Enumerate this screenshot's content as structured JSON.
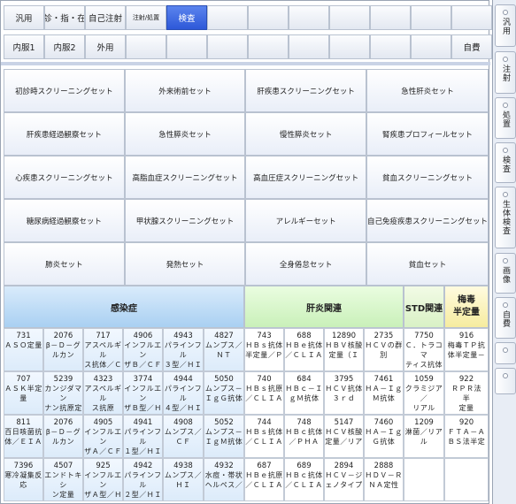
{
  "tabs_row1": [
    {
      "label": "汎用",
      "small": false,
      "active": false
    },
    {
      "label": "診・指・在",
      "small": false,
      "active": false
    },
    {
      "label": "自己注射",
      "small": false,
      "active": false
    },
    {
      "label": "注射/処置",
      "small": true,
      "active": false
    },
    {
      "label": "検査",
      "small": false,
      "active": true
    },
    {
      "label": "",
      "small": false,
      "active": false
    },
    {
      "label": "",
      "small": false,
      "active": false
    },
    {
      "label": "",
      "small": false,
      "active": false
    },
    {
      "label": "",
      "small": false,
      "active": false
    },
    {
      "label": "",
      "small": false,
      "active": false
    },
    {
      "label": "",
      "small": false,
      "active": false
    },
    {
      "label": "",
      "small": false,
      "active": false
    }
  ],
  "tabs_row2": [
    {
      "label": "内服1"
    },
    {
      "label": "内服2"
    },
    {
      "label": "外用"
    },
    {
      "label": ""
    },
    {
      "label": ""
    },
    {
      "label": ""
    },
    {
      "label": ""
    },
    {
      "label": ""
    },
    {
      "label": ""
    },
    {
      "label": ""
    },
    {
      "label": ""
    },
    {
      "label": "自費"
    }
  ],
  "sets": [
    "初診時スクリーニングセット",
    "外来術前セット",
    "肝疾患スクリーニングセット",
    "急性肝炎セット",
    "肝疾患経過観察セット",
    "急性膵炎セット",
    "慢性膵炎セット",
    "腎疾患プロフィールセット",
    "心疾患スクリーニングセット",
    "高脂血症スクリーニングセット",
    "高血圧症スクリーニングセット",
    "貧血スクリーニングセット",
    "糖尿病経過観察セット",
    "甲状腺スクリーニングセット",
    "アレルギーセット",
    "自己免疫疾患スクリーニングセット",
    "肺炎セット",
    "発熱セット",
    "全身倦怠セット",
    "貧血セット"
  ],
  "headers": {
    "infection": "感染症",
    "hepatitis": "肝炎関連",
    "std": "STD関連",
    "syphilis_line1": "梅毒",
    "syphilis_line2": "半定量"
  },
  "items": [
    {
      "code": "731",
      "lines": [
        "ＡＳＯ定量"
      ],
      "grp": "inf"
    },
    {
      "code": "2076",
      "lines": [
        "β－Ｄ－グ",
        "ルカン"
      ],
      "grp": "inf"
    },
    {
      "code": "717",
      "lines": [
        "アスペルギル",
        "ス抗体／Ｃ"
      ],
      "grp": "inf"
    },
    {
      "code": "4906",
      "lines": [
        "インフルエン",
        "ザＢ／ＣＦ"
      ],
      "grp": "inf"
    },
    {
      "code": "4943",
      "lines": [
        "パラインフル",
        "３型／ＨＩ"
      ],
      "grp": "inf"
    },
    {
      "code": "4827",
      "lines": [
        "ムンプス／",
        "ＮＴ"
      ],
      "grp": "inf"
    },
    {
      "code": "743",
      "lines": [
        "ＨＢｓ抗体",
        "半定量／Ｐ"
      ],
      "grp": "liv"
    },
    {
      "code": "688",
      "lines": [
        "ＨＢｅ抗体",
        "／ＣＬＩＡ"
      ],
      "grp": "liv"
    },
    {
      "code": "12890",
      "lines": [
        "ＨＢＶ核酸",
        "定量（Ｉ"
      ],
      "grp": "liv"
    },
    {
      "code": "2735",
      "lines": [
        "ＨＣＶの群",
        "別"
      ],
      "grp": "liv"
    },
    {
      "code": "7750",
      "lines": [
        "Ｃ．トラコマ",
        "ティス抗体"
      ],
      "grp": "liv"
    },
    {
      "code": "916",
      "lines": [
        "梅毒ＴＰ抗",
        "体半定量－"
      ],
      "grp": "liv"
    },
    {
      "code": "707",
      "lines": [
        "ＡＳＫ半定",
        "量"
      ],
      "grp": "inf"
    },
    {
      "code": "5239",
      "lines": [
        "カンジダマン",
        "ナン抗原定"
      ],
      "grp": "inf"
    },
    {
      "code": "4323",
      "lines": [
        "アスペルギル",
        "ス抗原"
      ],
      "grp": "inf"
    },
    {
      "code": "3774",
      "lines": [
        "インフルエン",
        "ザＢ型／Ｈ"
      ],
      "grp": "inf"
    },
    {
      "code": "4944",
      "lines": [
        "パラインフル",
        "４型／ＨＩ"
      ],
      "grp": "inf"
    },
    {
      "code": "5050",
      "lines": [
        "ムンプス－",
        "ＩｇＧ抗体"
      ],
      "grp": "inf"
    },
    {
      "code": "740",
      "lines": [
        "ＨＢｓ抗原",
        "／ＣＬＩＡ"
      ],
      "grp": "liv"
    },
    {
      "code": "684",
      "lines": [
        "ＨＢｃ－Ｉ",
        "ｇＭ抗体"
      ],
      "grp": "liv"
    },
    {
      "code": "3795",
      "lines": [
        "ＨＣＶ抗体",
        "３ｒｄ"
      ],
      "grp": "liv"
    },
    {
      "code": "7461",
      "lines": [
        "ＨＡ－Ｉｇ",
        "Ｍ抗体"
      ],
      "grp": "liv"
    },
    {
      "code": "1059",
      "lines": [
        "クラミジア／",
        "リアル"
      ],
      "grp": "liv"
    },
    {
      "code": "922",
      "lines": [
        "ＲＰＲ法　半",
        "定量"
      ],
      "grp": "liv"
    },
    {
      "code": "811",
      "lines": [
        "百日咳菌抗",
        "体／ＥＩＡ"
      ],
      "grp": "inf"
    },
    {
      "code": "2076",
      "lines": [
        "β－Ｄ－グ",
        "ルカン"
      ],
      "grp": "inf"
    },
    {
      "code": "4905",
      "lines": [
        "インフルエン",
        "ザＡ／ＣＦ"
      ],
      "grp": "inf"
    },
    {
      "code": "4941",
      "lines": [
        "パラインフル",
        "１型／ＨＩ"
      ],
      "grp": "inf"
    },
    {
      "code": "4908",
      "lines": [
        "ムンプス／",
        "ＣＦ"
      ],
      "grp": "inf"
    },
    {
      "code": "5052",
      "lines": [
        "ムンプス－",
        "ＩｇＭ抗体"
      ],
      "grp": "inf"
    },
    {
      "code": "744",
      "lines": [
        "ＨＢｓ抗体",
        "／ＣＬＩＡ"
      ],
      "grp": "liv"
    },
    {
      "code": "748",
      "lines": [
        "ＨＢｃ抗体",
        "／ＰＨＡ"
      ],
      "grp": "liv"
    },
    {
      "code": "5147",
      "lines": [
        "ＨＣＶ核酸",
        "定量／リア"
      ],
      "grp": "liv"
    },
    {
      "code": "7460",
      "lines": [
        "ＨＡ－Ｉｇ",
        "Ｇ抗体"
      ],
      "grp": "liv"
    },
    {
      "code": "1209",
      "lines": [
        "淋菌／リア",
        "ル"
      ],
      "grp": "liv"
    },
    {
      "code": "920",
      "lines": [
        "ＦＴＡ－Ａ",
        "ＢＳ法半定"
      ],
      "grp": "liv"
    },
    {
      "code": "7396",
      "lines": [
        "寒冷凝集反",
        "応"
      ],
      "grp": "inf"
    },
    {
      "code": "4507",
      "lines": [
        "エンドトキシ",
        "ン定量"
      ],
      "grp": "inf"
    },
    {
      "code": "925",
      "lines": [
        "インフルエン",
        "ザＡ型／Ｈ"
      ],
      "grp": "inf"
    },
    {
      "code": "4942",
      "lines": [
        "パラインフル",
        "２型／ＨＩ"
      ],
      "grp": "inf"
    },
    {
      "code": "4938",
      "lines": [
        "ムンプス／",
        "ＨＩ"
      ],
      "grp": "inf"
    },
    {
      "code": "4932",
      "lines": [
        "水痘・帯状",
        "ヘルペス／"
      ],
      "grp": "inf"
    },
    {
      "code": "687",
      "lines": [
        "ＨＢｅ抗原",
        "／ＣＬＩＡ"
      ],
      "grp": "liv"
    },
    {
      "code": "689",
      "lines": [
        "ＨＢｃ抗体",
        "／ＣＬＩＡ"
      ],
      "grp": "liv"
    },
    {
      "code": "2894",
      "lines": [
        "ＨＣＶ－ジ",
        "ェノタイプ"
      ],
      "grp": "liv"
    },
    {
      "code": "2888",
      "lines": [
        "ＨＤＶ－Ｒ",
        "ＮＡ定性"
      ],
      "grp": "liv"
    },
    {
      "code": "",
      "lines": [],
      "grp": "empty"
    },
    {
      "code": "",
      "lines": [],
      "grp": "empty"
    }
  ],
  "side_tabs": [
    {
      "label": "汎用"
    },
    {
      "label": "注射"
    },
    {
      "label": "処置"
    },
    {
      "label": "検査"
    },
    {
      "label": "生体検査"
    },
    {
      "label": "画像"
    },
    {
      "label": "自費"
    },
    {
      "label": ""
    },
    {
      "label": ""
    }
  ]
}
